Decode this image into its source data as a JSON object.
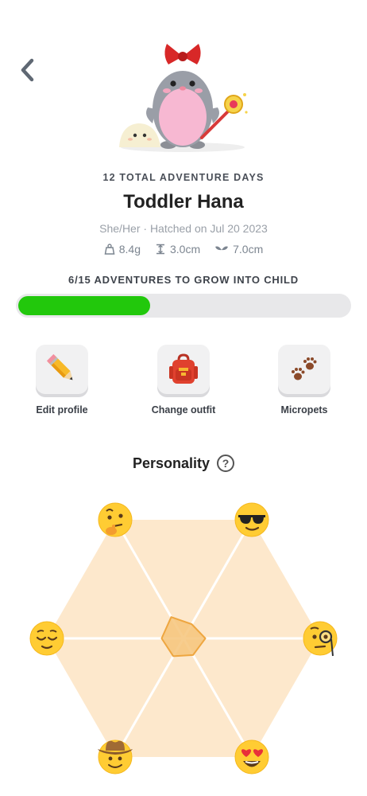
{
  "header": {
    "back_icon": "chevron-left-icon"
  },
  "pet": {
    "adventure_days": "12 TOTAL ADVENTURE DAYS",
    "name": "Toddler Hana",
    "meta": "She/Her · Hatched on Jul 20 2023",
    "stats": [
      {
        "icon": "scale-icon",
        "value": "8.4g"
      },
      {
        "icon": "height-icon",
        "value": "3.0cm"
      },
      {
        "icon": "wingspan-icon",
        "value": "7.0cm"
      }
    ]
  },
  "progress": {
    "label": "6/15 ADVENTURES TO GROW INTO CHILD",
    "current": 6,
    "total": 15,
    "fill_color": "#22c80c",
    "track_color": "#e8e8ea"
  },
  "actions": [
    {
      "label": "Edit profile",
      "icon": "pencil-icon"
    },
    {
      "label": "Change outfit",
      "icon": "backpack-icon"
    },
    {
      "label": "Micropets",
      "icon": "paw-prints-icon"
    }
  ],
  "personality": {
    "title": "Personality",
    "help_label": "?",
    "traits": [
      {
        "icon": "thinking-face-icon",
        "value": 0.18
      },
      {
        "icon": "sunglasses-face-icon",
        "value": 0.12
      },
      {
        "icon": "monocle-face-icon",
        "value": 0.16
      },
      {
        "icon": "heart-eyes-face-icon",
        "value": 0.14
      },
      {
        "icon": "cowboy-face-icon",
        "value": 0.15
      },
      {
        "icon": "relieved-face-icon",
        "value": 0.16
      }
    ],
    "fill_color": "#fde8cc",
    "shape_color": "#f6c47a"
  }
}
